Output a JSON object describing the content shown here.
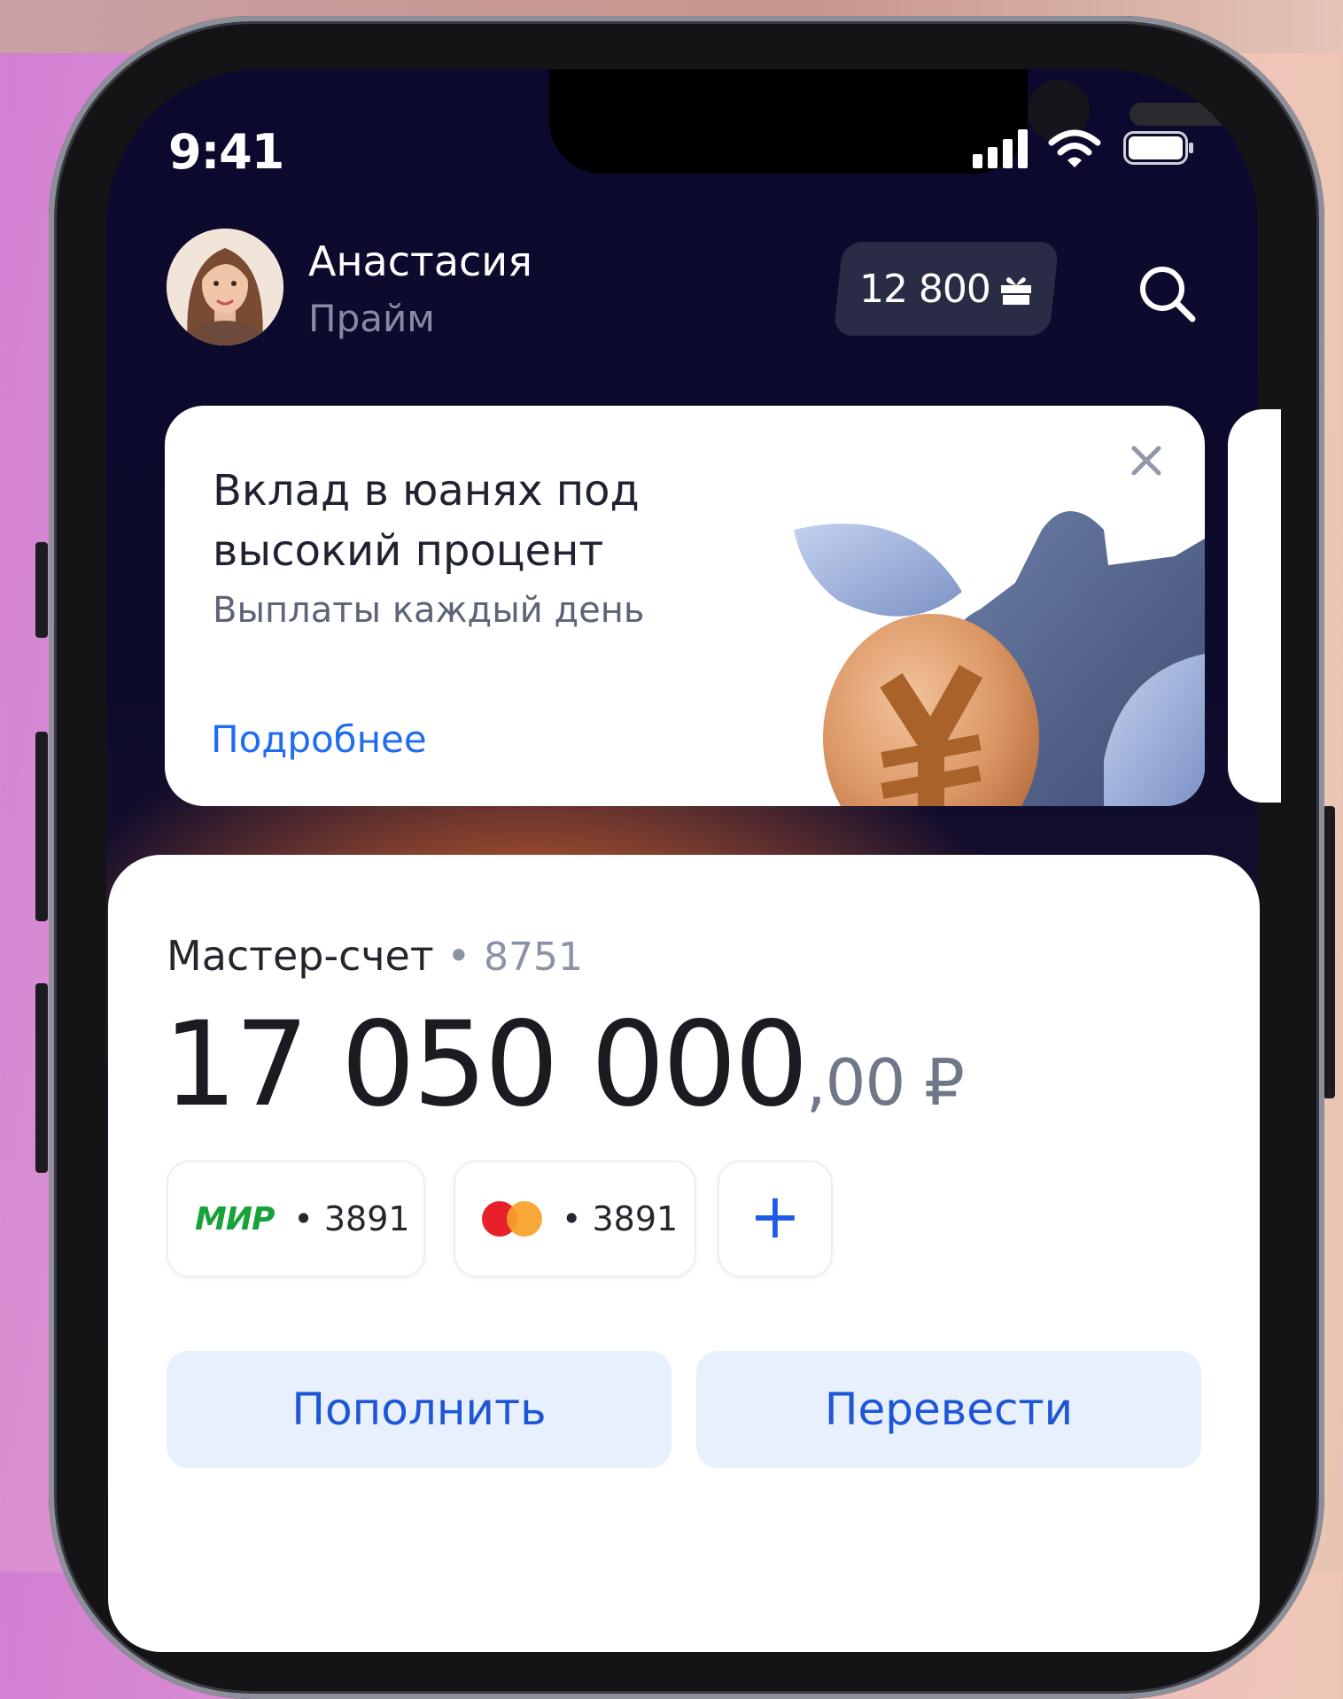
{
  "status_bar": {
    "time": "9:41",
    "icons": [
      "signal-icon",
      "wifi-icon",
      "battery-icon"
    ]
  },
  "header": {
    "user_name": "Анастасия",
    "user_plan": "Прайм",
    "points": "12 800",
    "points_icon": "gift-icon",
    "search_icon": "search-icon"
  },
  "promo": {
    "title": "Вклад в юанях под высокий процент",
    "subtitle": "Выплаты каждый день",
    "link": "Подробнее",
    "close_icon": "close-icon",
    "art_icon": "yuan-coin-icon"
  },
  "account": {
    "name": "Мастер-счет",
    "separator": "•",
    "number": "8751",
    "balance_main": "17 050 000",
    "balance_fraction": ",00 ₽",
    "cards": [
      {
        "brand": "МИР",
        "number": "• 3891"
      },
      {
        "brand": "mastercard",
        "number": "• 3891"
      }
    ],
    "add_card_label": "+",
    "actions": {
      "topup": "Пополнить",
      "transfer": "Перевести"
    }
  },
  "colors": {
    "accent": "#1e6cf0",
    "screen_bg": "#0b0a2e",
    "mir_green": "#18a23a",
    "button_bg": "#e9f0fd"
  }
}
